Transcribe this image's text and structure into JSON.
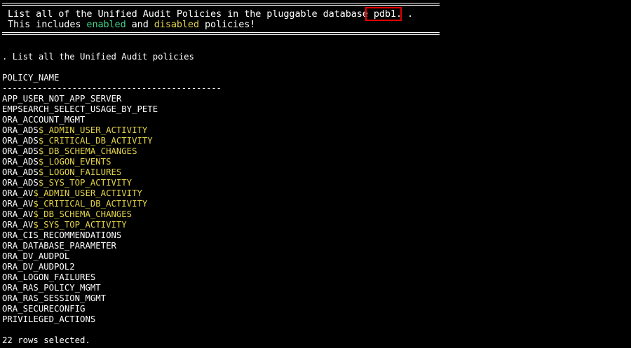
{
  "banner": {
    "line1_prefix": " List all of the Unified Audit Policies in the pluggable database ",
    "line1_db": "pdb1.",
    "line1_suffix": " .",
    "line2_prefix": " This includes ",
    "line2_enabled": "enabled",
    "line2_and": " and ",
    "line2_disabled": "disabled",
    "line2_suffix": " policies!"
  },
  "prompt_text": ". List all the Unified Audit policies",
  "column_header": "POLICY_NAME",
  "column_rule": "--------------------------------------------",
  "policies": [
    {
      "prefix": "APP_USER_NOT_APP_SERVER",
      "suffix": ""
    },
    {
      "prefix": "EMPSEARCH_SELECT_USAGE_BY_PETE",
      "suffix": ""
    },
    {
      "prefix": "ORA_ACCOUNT_MGMT",
      "suffix": ""
    },
    {
      "prefix": "ORA_ADS",
      "suffix": "$_ADMIN_USER_ACTIVITY"
    },
    {
      "prefix": "ORA_ADS",
      "suffix": "$_CRITICAL_DB_ACTIVITY"
    },
    {
      "prefix": "ORA_ADS",
      "suffix": "$_DB_SCHEMA_CHANGES"
    },
    {
      "prefix": "ORA_ADS",
      "suffix": "$_LOGON_EVENTS"
    },
    {
      "prefix": "ORA_ADS",
      "suffix": "$_LOGON_FAILURES"
    },
    {
      "prefix": "ORA_ADS",
      "suffix": "$_SYS_TOP_ACTIVITY"
    },
    {
      "prefix": "ORA_AV",
      "suffix": "$_ADMIN_USER_ACTIVITY"
    },
    {
      "prefix": "ORA_AV",
      "suffix": "$_CRITICAL_DB_ACTIVITY"
    },
    {
      "prefix": "ORA_AV",
      "suffix": "$_DB_SCHEMA_CHANGES"
    },
    {
      "prefix": "ORA_AV",
      "suffix": "$_SYS_TOP_ACTIVITY"
    },
    {
      "prefix": "ORA_CIS_RECOMMENDATIONS",
      "suffix": ""
    },
    {
      "prefix": "ORA_DATABASE_PARAMETER",
      "suffix": ""
    },
    {
      "prefix": "ORA_DV_AUDPOL",
      "suffix": ""
    },
    {
      "prefix": "ORA_DV_AUDPOL2",
      "suffix": ""
    },
    {
      "prefix": "ORA_LOGON_FAILURES",
      "suffix": ""
    },
    {
      "prefix": "ORA_RAS_POLICY_MGMT",
      "suffix": ""
    },
    {
      "prefix": "ORA_RAS_SESSION_MGMT",
      "suffix": ""
    },
    {
      "prefix": "ORA_SECURECONFIG",
      "suffix": ""
    },
    {
      "prefix": "PRIVILEGED_ACTIONS",
      "suffix": ""
    }
  ],
  "footer_text": "22 rows selected.",
  "colors": {
    "background": "#000000",
    "text": "#ffffff",
    "enabled": "#3dd68c",
    "highlight": "#e5d54a",
    "annotation_box": "#e00000"
  }
}
